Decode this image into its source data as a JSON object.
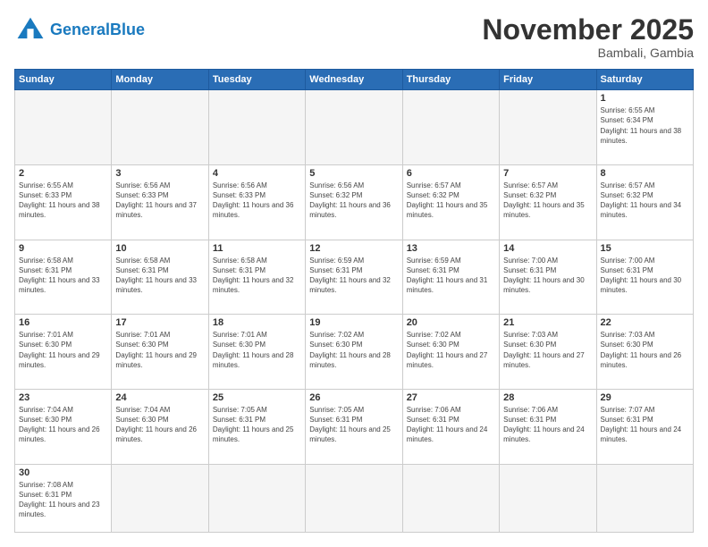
{
  "header": {
    "logo_general": "General",
    "logo_blue": "Blue",
    "month_title": "November 2025",
    "location": "Bambali, Gambia"
  },
  "days_of_week": [
    "Sunday",
    "Monday",
    "Tuesday",
    "Wednesday",
    "Thursday",
    "Friday",
    "Saturday"
  ],
  "weeks": [
    [
      {
        "day": "",
        "empty": true
      },
      {
        "day": "",
        "empty": true
      },
      {
        "day": "",
        "empty": true
      },
      {
        "day": "",
        "empty": true
      },
      {
        "day": "",
        "empty": true
      },
      {
        "day": "",
        "empty": true
      },
      {
        "day": "1",
        "sunrise": "6:55 AM",
        "sunset": "6:34 PM",
        "daylight": "11 hours and 38 minutes."
      }
    ],
    [
      {
        "day": "2",
        "sunrise": "6:55 AM",
        "sunset": "6:33 PM",
        "daylight": "11 hours and 38 minutes."
      },
      {
        "day": "3",
        "sunrise": "6:56 AM",
        "sunset": "6:33 PM",
        "daylight": "11 hours and 37 minutes."
      },
      {
        "day": "4",
        "sunrise": "6:56 AM",
        "sunset": "6:33 PM",
        "daylight": "11 hours and 36 minutes."
      },
      {
        "day": "5",
        "sunrise": "6:56 AM",
        "sunset": "6:32 PM",
        "daylight": "11 hours and 36 minutes."
      },
      {
        "day": "6",
        "sunrise": "6:57 AM",
        "sunset": "6:32 PM",
        "daylight": "11 hours and 35 minutes."
      },
      {
        "day": "7",
        "sunrise": "6:57 AM",
        "sunset": "6:32 PM",
        "daylight": "11 hours and 35 minutes."
      },
      {
        "day": "8",
        "sunrise": "6:57 AM",
        "sunset": "6:32 PM",
        "daylight": "11 hours and 34 minutes."
      }
    ],
    [
      {
        "day": "9",
        "sunrise": "6:58 AM",
        "sunset": "6:31 PM",
        "daylight": "11 hours and 33 minutes."
      },
      {
        "day": "10",
        "sunrise": "6:58 AM",
        "sunset": "6:31 PM",
        "daylight": "11 hours and 33 minutes."
      },
      {
        "day": "11",
        "sunrise": "6:58 AM",
        "sunset": "6:31 PM",
        "daylight": "11 hours and 32 minutes."
      },
      {
        "day": "12",
        "sunrise": "6:59 AM",
        "sunset": "6:31 PM",
        "daylight": "11 hours and 32 minutes."
      },
      {
        "day": "13",
        "sunrise": "6:59 AM",
        "sunset": "6:31 PM",
        "daylight": "11 hours and 31 minutes."
      },
      {
        "day": "14",
        "sunrise": "7:00 AM",
        "sunset": "6:31 PM",
        "daylight": "11 hours and 30 minutes."
      },
      {
        "day": "15",
        "sunrise": "7:00 AM",
        "sunset": "6:31 PM",
        "daylight": "11 hours and 30 minutes."
      }
    ],
    [
      {
        "day": "16",
        "sunrise": "7:01 AM",
        "sunset": "6:30 PM",
        "daylight": "11 hours and 29 minutes."
      },
      {
        "day": "17",
        "sunrise": "7:01 AM",
        "sunset": "6:30 PM",
        "daylight": "11 hours and 29 minutes."
      },
      {
        "day": "18",
        "sunrise": "7:01 AM",
        "sunset": "6:30 PM",
        "daylight": "11 hours and 28 minutes."
      },
      {
        "day": "19",
        "sunrise": "7:02 AM",
        "sunset": "6:30 PM",
        "daylight": "11 hours and 28 minutes."
      },
      {
        "day": "20",
        "sunrise": "7:02 AM",
        "sunset": "6:30 PM",
        "daylight": "11 hours and 27 minutes."
      },
      {
        "day": "21",
        "sunrise": "7:03 AM",
        "sunset": "6:30 PM",
        "daylight": "11 hours and 27 minutes."
      },
      {
        "day": "22",
        "sunrise": "7:03 AM",
        "sunset": "6:30 PM",
        "daylight": "11 hours and 26 minutes."
      }
    ],
    [
      {
        "day": "23",
        "sunrise": "7:04 AM",
        "sunset": "6:30 PM",
        "daylight": "11 hours and 26 minutes."
      },
      {
        "day": "24",
        "sunrise": "7:04 AM",
        "sunset": "6:30 PM",
        "daylight": "11 hours and 26 minutes."
      },
      {
        "day": "25",
        "sunrise": "7:05 AM",
        "sunset": "6:31 PM",
        "daylight": "11 hours and 25 minutes."
      },
      {
        "day": "26",
        "sunrise": "7:05 AM",
        "sunset": "6:31 PM",
        "daylight": "11 hours and 25 minutes."
      },
      {
        "day": "27",
        "sunrise": "7:06 AM",
        "sunset": "6:31 PM",
        "daylight": "11 hours and 24 minutes."
      },
      {
        "day": "28",
        "sunrise": "7:06 AM",
        "sunset": "6:31 PM",
        "daylight": "11 hours and 24 minutes."
      },
      {
        "day": "29",
        "sunrise": "7:07 AM",
        "sunset": "6:31 PM",
        "daylight": "11 hours and 24 minutes."
      }
    ],
    [
      {
        "day": "30",
        "sunrise": "7:08 AM",
        "sunset": "6:31 PM",
        "daylight": "11 hours and 23 minutes."
      },
      {
        "day": "",
        "empty": true
      },
      {
        "day": "",
        "empty": true
      },
      {
        "day": "",
        "empty": true
      },
      {
        "day": "",
        "empty": true
      },
      {
        "day": "",
        "empty": true
      },
      {
        "day": "",
        "empty": true
      }
    ]
  ]
}
